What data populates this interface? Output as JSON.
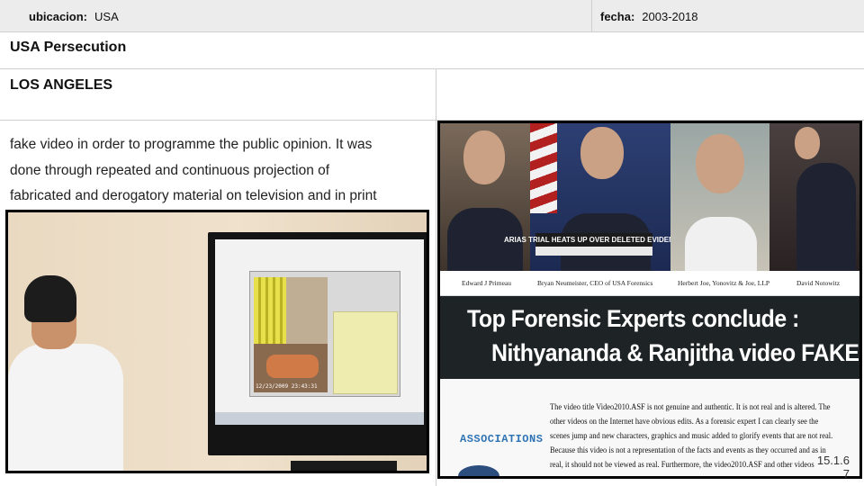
{
  "header": {
    "location_label": "ubicacion:",
    "location_value": "USA",
    "date_label": "fecha:",
    "date_value": "2003-2018"
  },
  "section_title": "USA Persecution",
  "city": "LOS ANGELES",
  "paragraph_lines": [
    "fake video in order to programme the public opinion. It was",
    "done through repeated and continuous projection of",
    "fabricated and derogatory material on television and in print"
  ],
  "right_image": {
    "news_chyron": "ARIAS TRIAL HEATS UP OVER DELETED EVIDENCE",
    "names": [
      "Edward J Primeau",
      "Bryan Neumeister, CEO of USA Forensics",
      "Herbert Joe, Yonovitz & Joe, LLP",
      "David Notowitz"
    ],
    "banner_line1": "Top Forensic Experts  conclude :",
    "banner_line2": "Nithyananda & Ranjitha video FAKE",
    "sidebar_label": "ASSOCIATIONS",
    "doc_lines": [
      "The video title Video2010.ASF is not genuine and authentic.  It is not real and is altered.  The",
      "other videos on the Internet have obvious edits.  As a forensic expert I can clearly see the",
      "scenes jump and new characters, graphics and music added to glorify events that are not real.",
      "Because this video is not a representation of the facts and events as they occurred and as in",
      "real, it should not be viewed as real.  Furthermore, the video2010.ASF and other videos"
    ]
  },
  "left_image": {
    "timestamp": "12/23/2009  23:43:31"
  },
  "page_number": "15.1.6\n7"
}
